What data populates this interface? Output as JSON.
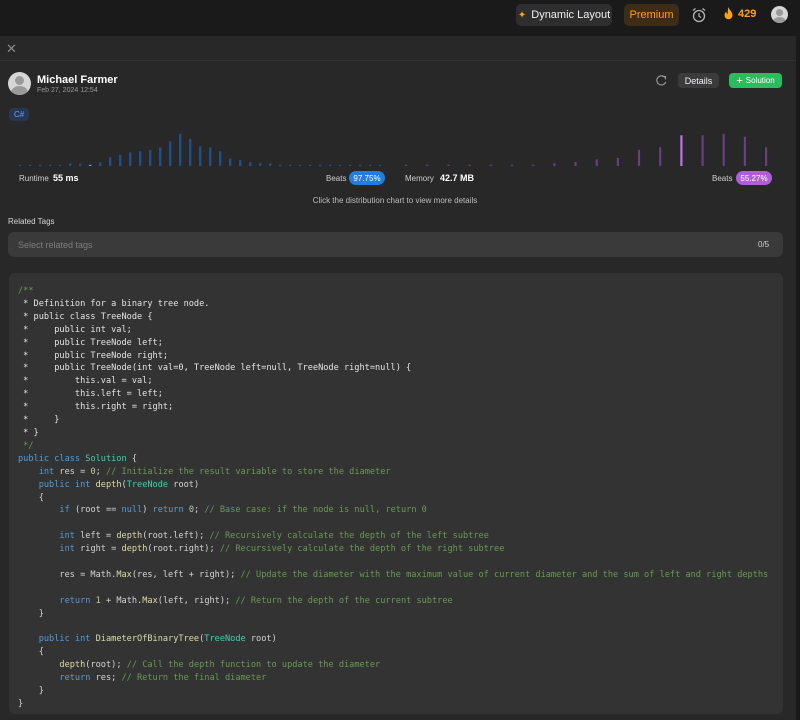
{
  "topbar": {
    "dynamic_layout": "Dynamic Layout",
    "premium": "Premium",
    "streak_count": "429",
    "icons": [
      "sparkle-icon",
      "alarm-clock-icon",
      "fire-icon",
      "user-avatar"
    ]
  },
  "author": {
    "name": "Michael Farmer",
    "date": "Feb 27, 2024 12:54"
  },
  "actions": {
    "details": "Details",
    "solution": "Solution"
  },
  "language": "C#",
  "stats": {
    "runtime_label": "Runtime",
    "runtime_value": "55 ms",
    "runtime_beats_label": "Beats",
    "runtime_beats": "97.75%",
    "memory_label": "Memory",
    "memory_value": "42.7 MB",
    "memory_beats_label": "Beats",
    "memory_beats": "55.27%",
    "hint": "Click the distribution chart to view more details"
  },
  "chart_data": [
    {
      "type": "bar",
      "title": "",
      "colors": {
        "bars": "#1f4f86",
        "current": "#5aa5ff"
      },
      "values": [
        1,
        1,
        1,
        1,
        1,
        2,
        2,
        1,
        3,
        7,
        9,
        11,
        12,
        13,
        15,
        20,
        26,
        22,
        16,
        15,
        12,
        6,
        5,
        3,
        2,
        2,
        1,
        1,
        1,
        1,
        1,
        1,
        1,
        1,
        1,
        1,
        1
      ],
      "current_index": 7
    },
    {
      "type": "bar",
      "title": "",
      "colors": {
        "bars": "#6a3f80",
        "current": "#c46ef0"
      },
      "values": [
        1,
        1,
        1,
        1,
        1,
        1,
        1,
        2,
        3,
        5,
        6,
        12,
        14,
        23,
        23,
        24,
        22,
        14
      ],
      "current_index": 13
    }
  ],
  "related_tags": {
    "title": "Related Tags",
    "placeholder": "Select related tags",
    "count": "0/5"
  },
  "code_lines": [
    [
      {
        "t": "/**",
        "c": "c"
      }
    ],
    [
      {
        "t": " * Definition for a binary tree node.",
        "c": "w"
      }
    ],
    [
      {
        "t": " * public class TreeNode {",
        "c": "w"
      }
    ],
    [
      {
        "t": " *     public int val;",
        "c": "w"
      }
    ],
    [
      {
        "t": " *     public TreeNode left;",
        "c": "w"
      }
    ],
    [
      {
        "t": " *     public TreeNode right;",
        "c": "w"
      }
    ],
    [
      {
        "t": " *     public TreeNode(int val=0, TreeNode left=null, TreeNode right=null) {",
        "c": "w"
      }
    ],
    [
      {
        "t": " *         this.val = val;",
        "c": "w"
      }
    ],
    [
      {
        "t": " *         this.left = left;",
        "c": "w"
      }
    ],
    [
      {
        "t": " *         this.right = right;",
        "c": "w"
      }
    ],
    [
      {
        "t": " *     }",
        "c": "w"
      }
    ],
    [
      {
        "t": " * }",
        "c": "w"
      }
    ],
    [
      {
        "t": " */",
        "c": "c"
      }
    ],
    [
      {
        "t": "public class ",
        "c": "k"
      },
      {
        "t": "Solution",
        "c": "ty"
      },
      {
        "t": " {",
        "c": "p"
      }
    ],
    [
      {
        "t": "    ",
        "c": "p"
      },
      {
        "t": "int",
        "c": "k"
      },
      {
        "t": " res = ",
        "c": "p"
      },
      {
        "t": "0",
        "c": "n"
      },
      {
        "t": "; ",
        "c": "p"
      },
      {
        "t": "// Initialize the result variable to store the diameter",
        "c": "c"
      }
    ],
    [
      {
        "t": "    ",
        "c": "p"
      },
      {
        "t": "public int ",
        "c": "k"
      },
      {
        "t": "depth",
        "c": "f"
      },
      {
        "t": "(",
        "c": "p"
      },
      {
        "t": "TreeNode",
        "c": "ty"
      },
      {
        "t": " root)",
        "c": "p"
      }
    ],
    [
      {
        "t": "    {",
        "c": "p"
      }
    ],
    [
      {
        "t": "        ",
        "c": "p"
      },
      {
        "t": "if",
        "c": "k"
      },
      {
        "t": " (root == ",
        "c": "p"
      },
      {
        "t": "null",
        "c": "k"
      },
      {
        "t": ") ",
        "c": "p"
      },
      {
        "t": "return",
        "c": "k"
      },
      {
        "t": " ",
        "c": "p"
      },
      {
        "t": "0",
        "c": "n"
      },
      {
        "t": "; ",
        "c": "p"
      },
      {
        "t": "// Base case: if the node is null, return 0",
        "c": "c"
      }
    ],
    [
      {
        "t": "",
        "c": "p"
      }
    ],
    [
      {
        "t": "        ",
        "c": "p"
      },
      {
        "t": "int",
        "c": "k"
      },
      {
        "t": " left = ",
        "c": "p"
      },
      {
        "t": "depth",
        "c": "f"
      },
      {
        "t": "(root.left); ",
        "c": "p"
      },
      {
        "t": "// Recursively calculate the depth of the left subtree",
        "c": "c"
      }
    ],
    [
      {
        "t": "        ",
        "c": "p"
      },
      {
        "t": "int",
        "c": "k"
      },
      {
        "t": " right = ",
        "c": "p"
      },
      {
        "t": "depth",
        "c": "f"
      },
      {
        "t": "(root.right); ",
        "c": "p"
      },
      {
        "t": "// Recursively calculate the depth of the right subtree",
        "c": "c"
      }
    ],
    [
      {
        "t": "",
        "c": "p"
      }
    ],
    [
      {
        "t": "        res = Math.",
        "c": "p"
      },
      {
        "t": "Max",
        "c": "f"
      },
      {
        "t": "(res, left + right); ",
        "c": "p"
      },
      {
        "t": "// Update the diameter with the maximum value of current diameter and the sum of left and right depths",
        "c": "c"
      }
    ],
    [
      {
        "t": "",
        "c": "p"
      }
    ],
    [
      {
        "t": "        ",
        "c": "p"
      },
      {
        "t": "return",
        "c": "k"
      },
      {
        "t": " ",
        "c": "p"
      },
      {
        "t": "1",
        "c": "n"
      },
      {
        "t": " + Math.",
        "c": "p"
      },
      {
        "t": "Max",
        "c": "f"
      },
      {
        "t": "(left, right); ",
        "c": "p"
      },
      {
        "t": "// Return the depth of the current subtree",
        "c": "c"
      }
    ],
    [
      {
        "t": "    }",
        "c": "p"
      }
    ],
    [
      {
        "t": "",
        "c": "p"
      }
    ],
    [
      {
        "t": "    ",
        "c": "p"
      },
      {
        "t": "public int ",
        "c": "k"
      },
      {
        "t": "DiameterOfBinaryTree",
        "c": "f"
      },
      {
        "t": "(",
        "c": "p"
      },
      {
        "t": "TreeNode",
        "c": "ty"
      },
      {
        "t": " root)",
        "c": "p"
      }
    ],
    [
      {
        "t": "    {",
        "c": "p"
      }
    ],
    [
      {
        "t": "        ",
        "c": "p"
      },
      {
        "t": "depth",
        "c": "f"
      },
      {
        "t": "(root); ",
        "c": "p"
      },
      {
        "t": "// Call the depth function to update the diameter",
        "c": "c"
      }
    ],
    [
      {
        "t": "        ",
        "c": "p"
      },
      {
        "t": "return",
        "c": "k"
      },
      {
        "t": " res; ",
        "c": "p"
      },
      {
        "t": "// Return the final diameter",
        "c": "c"
      }
    ],
    [
      {
        "t": "    }",
        "c": "p"
      }
    ],
    [
      {
        "t": "}",
        "c": "p"
      }
    ]
  ],
  "code_colors": {
    "c": "#6a9955",
    "w": "#e4e4e4",
    "k": "#569cd6",
    "ty": "#4ec9b0",
    "f": "#dcdcaa",
    "n": "#b5cea8",
    "p": "#d4d4d4"
  }
}
